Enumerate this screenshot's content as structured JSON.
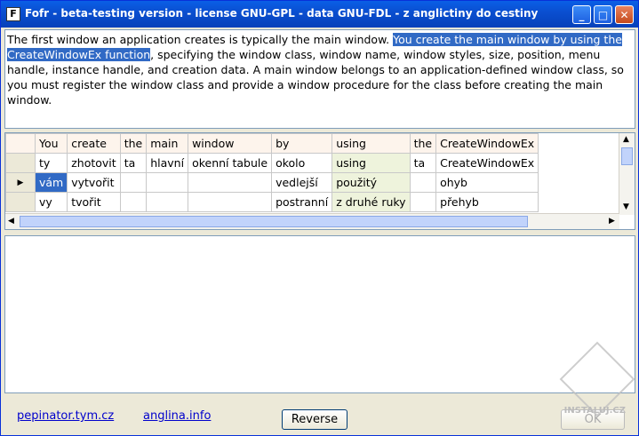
{
  "window": {
    "title": "Fofr - beta-testing version - license GNU-GPL - data GNU-FDL - z anglictiny do cestiny",
    "icon_letter": "F",
    "minimize": "_",
    "maximize": "□",
    "close": "✕"
  },
  "source_text": {
    "before": "The first window an application creates is typically the main window. ",
    "selected": "You create the main window by using the CreateWindowEx function",
    "after": ", specifying the window class, window name, window styles, size, position, menu handle, instance handle, and creation data. A main window belongs to an application-defined window class, so you must register the window class and provide a window procedure for the class before creating the main window."
  },
  "grid": {
    "headers": [
      "You",
      "create",
      "the",
      "main",
      "window",
      "by",
      "using",
      "the",
      "CreateWindowEx"
    ],
    "rows": [
      [
        "ty",
        "zhotovit",
        "ta",
        "hlavní",
        "okenní tabule",
        "okolo",
        "using",
        "ta",
        "CreateWindowEx"
      ],
      [
        "vám",
        "vytvořit",
        "",
        "",
        "",
        "vedlejší",
        "použitý",
        "",
        "ohyb"
      ],
      [
        "vy",
        "tvořit",
        "",
        "",
        "",
        "postranní",
        "z druhé ruky",
        "",
        "přehyb"
      ]
    ],
    "row_indicator": "▶"
  },
  "footer": {
    "link1": "pepinator.tym.cz",
    "link2": "anglina.info",
    "reverse_label": "Reverse",
    "ok_label": "OK",
    "watermark": "INSTALUJ.CZ"
  }
}
